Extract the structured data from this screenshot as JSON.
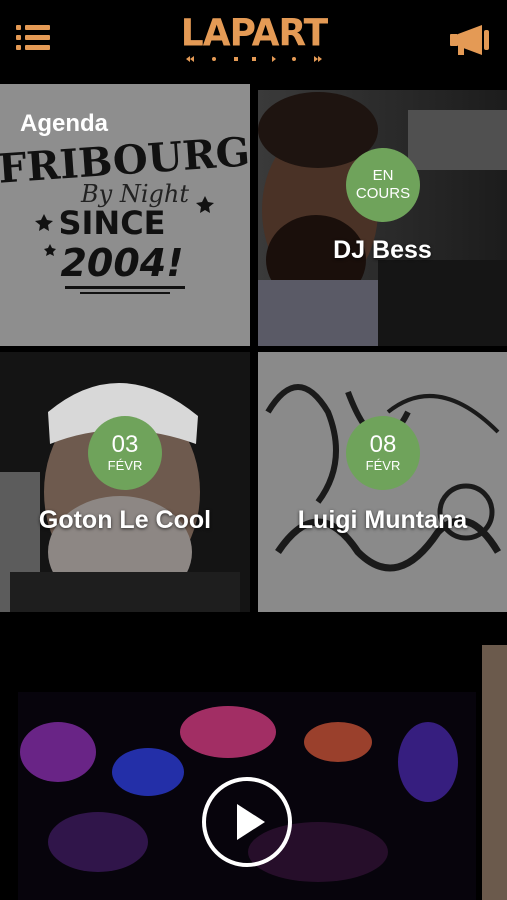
{
  "header": {
    "logo_text": "LAPART",
    "menu_icon": "hamburger-menu-icon",
    "announce_icon": "megaphone-icon",
    "accent_color": "#e49a55"
  },
  "tiles": [
    {
      "label": "Agenda",
      "art_line1": "FRIBOURG",
      "art_line2": "By Night",
      "art_line3": "SINCE",
      "art_line4": "2004!"
    },
    {
      "name": "DJ Bess",
      "badge_line1": "EN",
      "badge_line2": "COURS"
    },
    {
      "name": "Goton Le Cool",
      "badge_day": "03",
      "badge_month": "FÉVR"
    },
    {
      "name": "Luigi Muntana",
      "badge_day": "08",
      "badge_month": "FÉVR"
    }
  ],
  "video": {
    "play_icon": "play-icon"
  },
  "colors": {
    "badge": "#6fa35b",
    "tile_gray": "#8e8e8e"
  }
}
